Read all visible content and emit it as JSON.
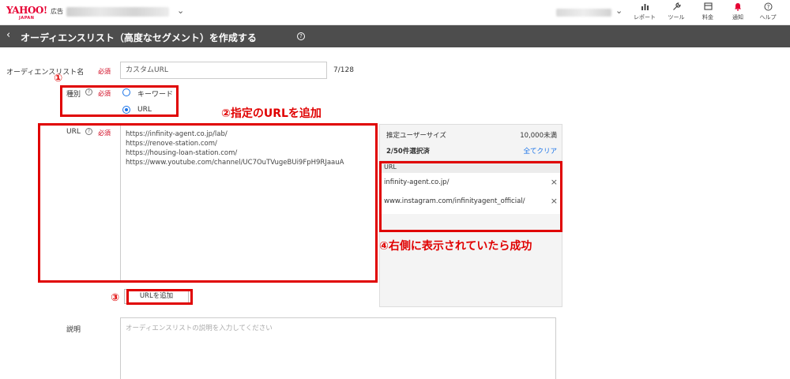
{
  "header": {
    "logo_main": "YAHOO!",
    "logo_sub": "広告",
    "logo_japan": "JAPAN",
    "nav": [
      {
        "label": "レポート",
        "icon": "bar-chart-icon"
      },
      {
        "label": "ツール",
        "icon": "wrench-icon"
      },
      {
        "label": "料金",
        "icon": "billing-icon"
      },
      {
        "label": "通知",
        "icon": "bell-icon"
      },
      {
        "label": "ヘルプ",
        "icon": "help-icon"
      }
    ]
  },
  "page": {
    "title": "オーディエンスリスト（高度なセグメント）を作成する"
  },
  "form": {
    "name_label": "オーディエンスリスト名",
    "required": "必須",
    "name_value": "カスタムURL",
    "name_count": "7/128",
    "type_label": "種別",
    "type_options": [
      {
        "label": "キーワード",
        "selected": false
      },
      {
        "label": "URL",
        "selected": true
      }
    ],
    "url_label": "URL",
    "url_lines": [
      "https://infinity-agent.co.jp/lab/",
      "https://renove-station.com/",
      "https://housing-loan-station.com/",
      "https://www.youtube.com/channel/UC7OuTVugeBUi9FpH9RJaauA"
    ],
    "add_button": "URLを追加",
    "desc_label": "説明",
    "desc_placeholder": "オーディエンスリストの説明を入力してください"
  },
  "panel": {
    "estimated_label": "推定ユーザーサイズ",
    "estimated_value": "10,000未満",
    "selected_count": "2/50件選択済",
    "clear_all": "全てクリア",
    "list_header": "URL",
    "items": [
      "infinity-agent.co.jp/",
      "www.instagram.com/infinityagent_official/"
    ]
  },
  "annotations": {
    "n1": "①",
    "n2": "②指定のURLを追加",
    "n3": "③",
    "n4": "④右側に表示されていたら成功"
  },
  "colors": {
    "brand_red": "#e60033",
    "annotation_red": "#e00000",
    "title_bar": "#4d4d4d",
    "link_blue": "#1a73e8"
  }
}
